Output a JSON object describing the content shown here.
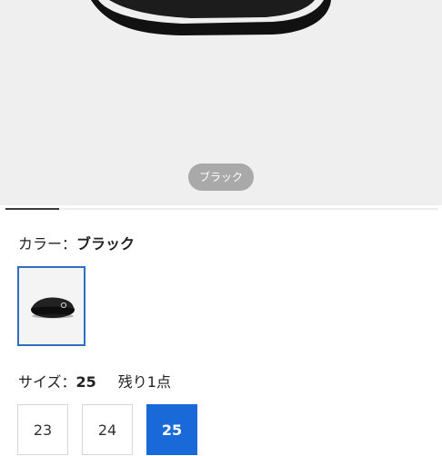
{
  "product": {
    "hero_color_label": "ブラック",
    "image_count_indicator": {
      "current": 1
    }
  },
  "color": {
    "label": "カラー：",
    "value": "ブラック",
    "swatches": [
      {
        "name": "ブラック",
        "selected": true
      }
    ]
  },
  "size": {
    "label": "サイズ：",
    "value": "25",
    "stock_note": "残り1点",
    "options": [
      {
        "label": "23",
        "selected": false
      },
      {
        "label": "24",
        "selected": false
      },
      {
        "label": "25",
        "selected": true
      }
    ]
  },
  "colors": {
    "accent": "#1969d8",
    "swatch_border": "#2e6fc0",
    "pill_bg": "#a9a9a9",
    "hero_bg": "#efefef"
  }
}
